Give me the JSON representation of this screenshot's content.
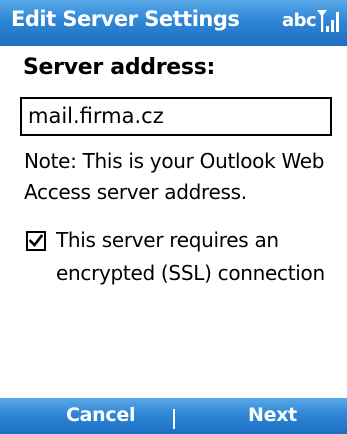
{
  "titlebar": {
    "title": "Edit Server Settings",
    "input_mode": "abc",
    "signal_icon": "signal-strength-icon"
  },
  "form": {
    "server_address_label": "Server address:",
    "server_address_value": "mail.firma.cz",
    "note": "Note: This is your Outlook Web Access server address.",
    "ssl_checkbox_checked": true,
    "ssl_checkbox_label": "This server requires an encrypted (SSL) connection"
  },
  "softkeys": {
    "left": "Cancel",
    "right": "Next"
  },
  "colors": {
    "bar_top": "#5aa9e8",
    "bar_bottom": "#1c6fc2",
    "bar_text": "#ffffff",
    "background": "#ffffff",
    "text": "#000000"
  }
}
